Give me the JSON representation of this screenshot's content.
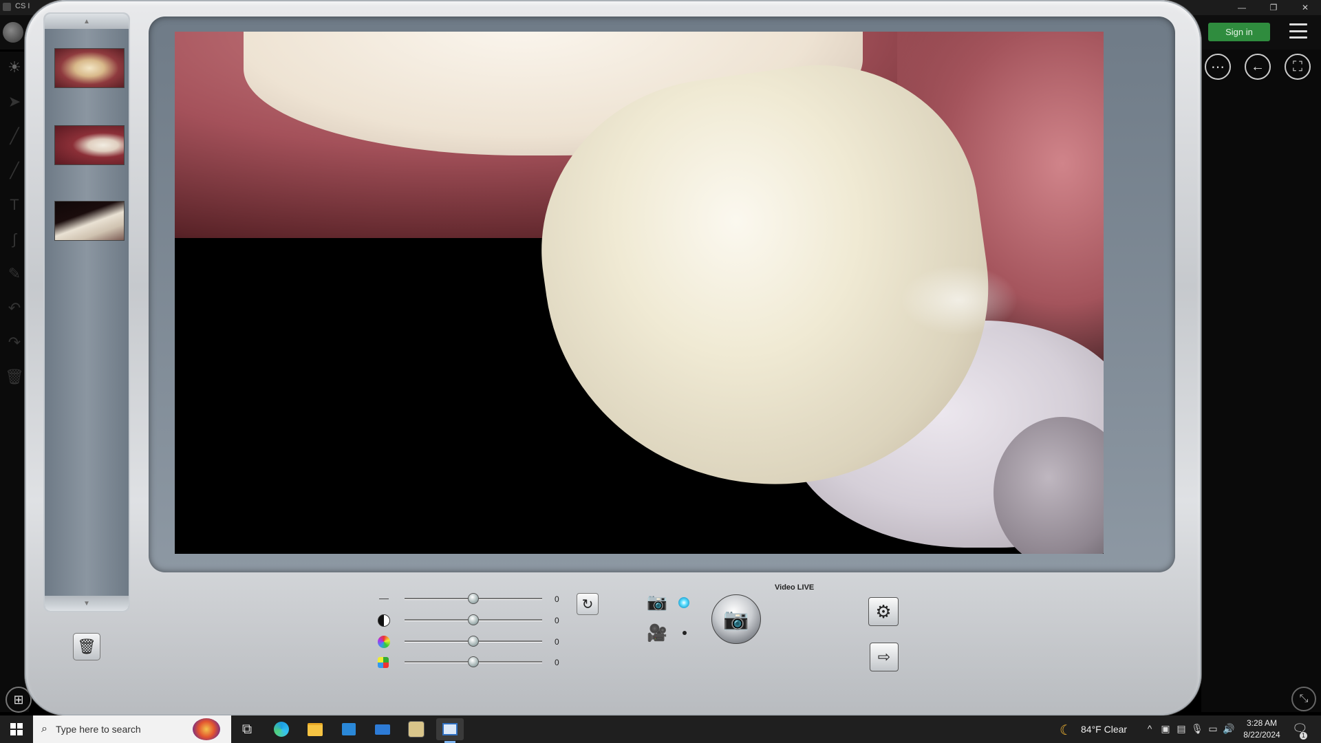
{
  "host": {
    "title": "CS I",
    "sign_in_label": "Sign in",
    "window_controls": [
      "—",
      "❐",
      "✕"
    ],
    "more_label": "⋯",
    "back_label": "←",
    "fullscreen_label": "⛶",
    "apps_label": "⊞",
    "corner_label": "⤡"
  },
  "camera": {
    "thumbnails": [
      {
        "name": "thumbnail-1"
      },
      {
        "name": "thumbnail-2"
      },
      {
        "name": "thumbnail-3"
      }
    ],
    "sliders": [
      {
        "name": "brightness",
        "icon": "brightness-icon",
        "value": "0",
        "level": 0.5
      },
      {
        "name": "contrast",
        "icon": "contrast-icon",
        "value": "0",
        "level": 0.5
      },
      {
        "name": "saturation",
        "icon": "saturation-icon",
        "value": "0",
        "level": 0.5
      },
      {
        "name": "hue",
        "icon": "hue-icon",
        "value": "0",
        "level": 0.5
      }
    ],
    "mode": "photo",
    "video_live_label": "Video LIVE",
    "capture_glyph": "📷",
    "reset_glyph": "↻",
    "settings_glyph": "⚙",
    "exit_glyph": "⇨",
    "delete_glyph": "🗑",
    "photo_mode_glyph": "📷",
    "video_mode_glyph": "🎥",
    "scroll_up_glyph": "▲",
    "scroll_down_glyph": "▼"
  },
  "taskbar": {
    "search_placeholder": "Type here to search",
    "search_glyph": "⌕",
    "taskview_glyph": "⧉",
    "weather": "84°F  Clear",
    "weather_glyph": "☾",
    "tray_chevron": "^",
    "time": "3:28 AM",
    "date": "8/22/2024",
    "notification_glyph": "🗨",
    "notification_count": "1"
  }
}
